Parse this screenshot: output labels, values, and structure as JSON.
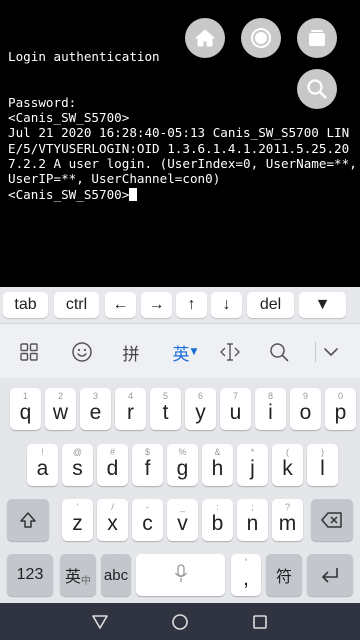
{
  "terminal": {
    "lines": [
      "Login authentication",
      "",
      "",
      "Password:",
      "<Canis_SW_S5700>",
      "Jul 21 2020 16:28:40-05:13 Canis_SW_S5700 LINE/5/VTYUSERLOGIN:OID 1.3.6.1.4.1.2011.5.25.207.2.2 A user login. (UserIndex=0, UserName=**, UserIP=**, UserChannel=con0)"
    ],
    "prompt": "<Canis_SW_S5700>"
  },
  "floating_buttons": [
    "home-icon",
    "record-icon",
    "window-icon",
    "search-icon"
  ],
  "extra_keys": [
    "tab",
    "ctrl",
    "←",
    "→",
    "↑",
    "↓",
    "del",
    "▼"
  ],
  "ime": {
    "language": "英",
    "pinyin": "拼",
    "icons": [
      "grid-icon",
      "emoji-icon",
      "cursor-icon",
      "search-icon",
      "collapse-icon"
    ]
  },
  "keyboard": {
    "row1": [
      {
        "main": "q",
        "sub": "1"
      },
      {
        "main": "w",
        "sub": "2"
      },
      {
        "main": "e",
        "sub": "3"
      },
      {
        "main": "r",
        "sub": "4"
      },
      {
        "main": "t",
        "sub": "5"
      },
      {
        "main": "y",
        "sub": "6"
      },
      {
        "main": "u",
        "sub": "7"
      },
      {
        "main": "i",
        "sub": "8"
      },
      {
        "main": "o",
        "sub": "9"
      },
      {
        "main": "p",
        "sub": "0"
      }
    ],
    "row2": [
      {
        "main": "a",
        "sub": "!"
      },
      {
        "main": "s",
        "sub": "@"
      },
      {
        "main": "d",
        "sub": "#"
      },
      {
        "main": "f",
        "sub": "$"
      },
      {
        "main": "g",
        "sub": "%"
      },
      {
        "main": "h",
        "sub": "&"
      },
      {
        "main": "j",
        "sub": "*"
      },
      {
        "main": "k",
        "sub": "("
      },
      {
        "main": "l",
        "sub": ")"
      }
    ],
    "row3": [
      {
        "main": "z",
        "sub": "'"
      },
      {
        "main": "x",
        "sub": "/"
      },
      {
        "main": "c",
        "sub": "-"
      },
      {
        "main": "v",
        "sub": "_"
      },
      {
        "main": "b",
        "sub": ":"
      },
      {
        "main": "n",
        "sub": ";"
      },
      {
        "main": "m",
        "sub": "?"
      }
    ],
    "bottom": {
      "num": "123",
      "lang_main": "英",
      "lang_sub": "中",
      "abc": "abc",
      "punct_top": "'",
      "punct_main": ",",
      "symbol": "符"
    }
  },
  "colors": {
    "ime_accent": "#1a6ed8",
    "navbar": "#2f3440"
  }
}
